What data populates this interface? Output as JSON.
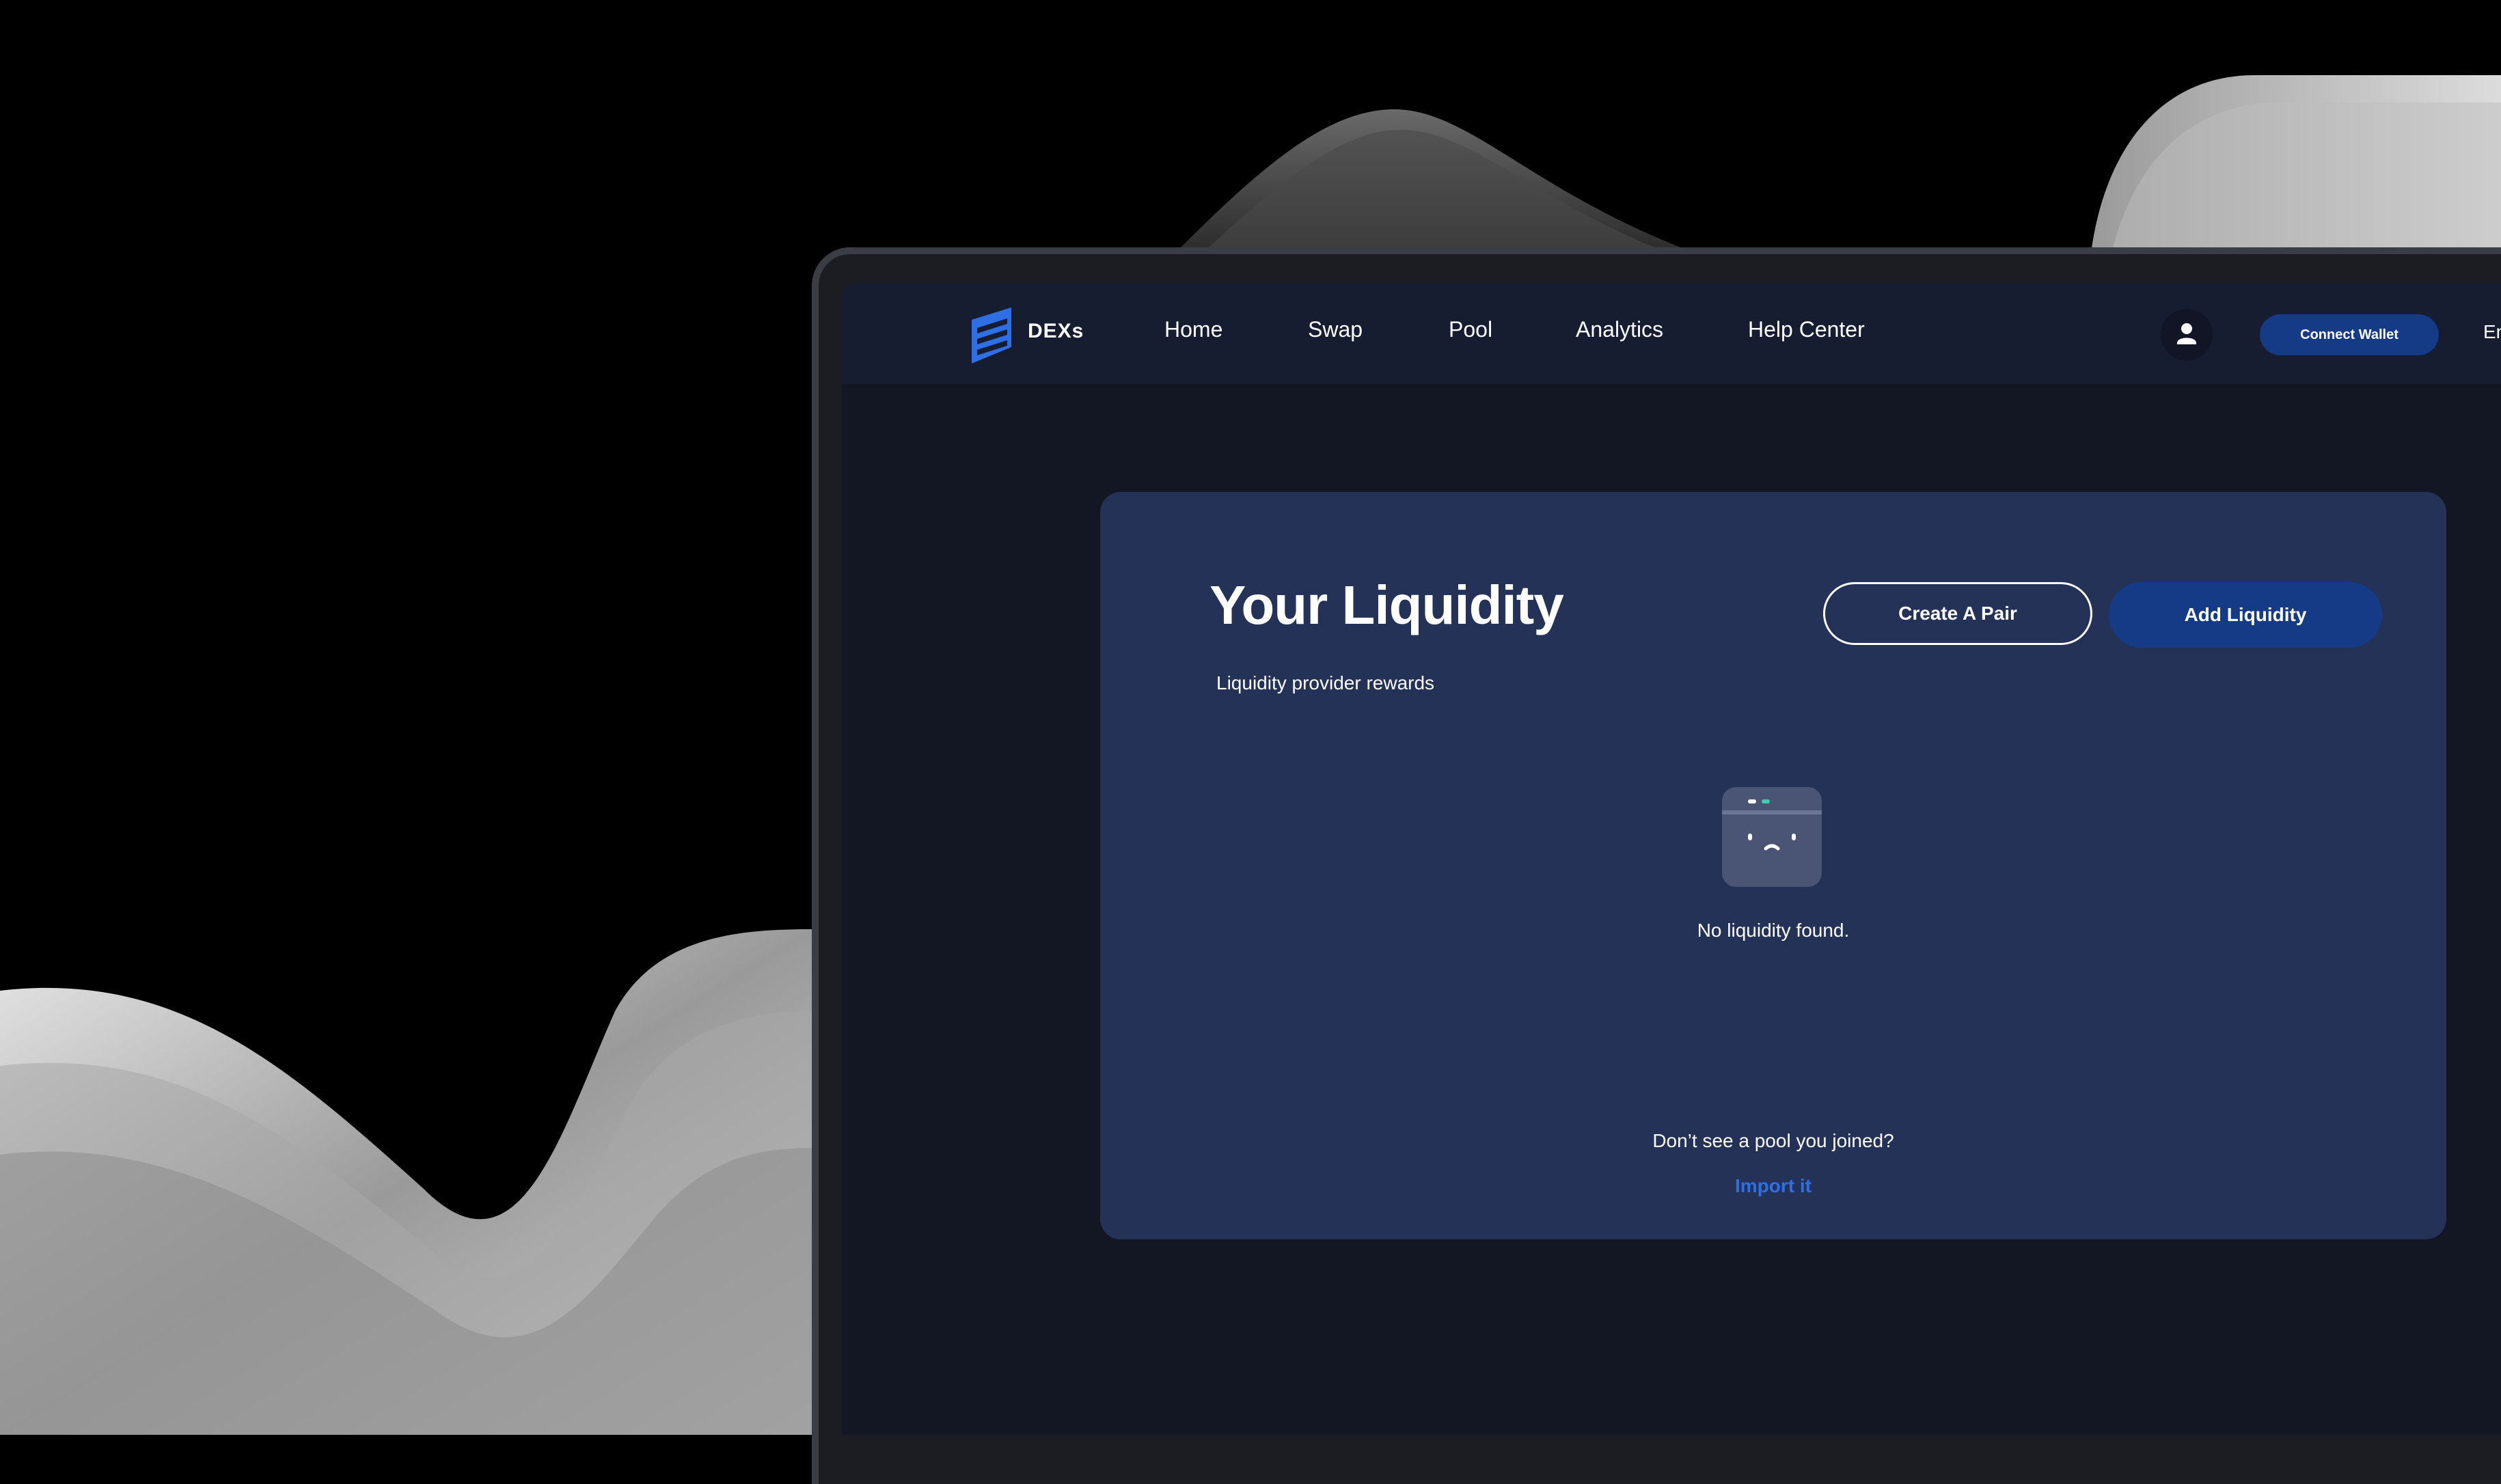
{
  "brand": {
    "name": "DEXs",
    "logo_icon": "dexs-logo-icon",
    "accent": "#2f6fe6"
  },
  "nav": {
    "items": [
      {
        "label": "Home"
      },
      {
        "label": "Swap"
      },
      {
        "label": "Pool"
      },
      {
        "label": "Analytics"
      },
      {
        "label": "Help Center"
      }
    ],
    "avatar_icon": "user-icon",
    "connect_label": "Connect Wallet",
    "language_partial": "En"
  },
  "liquidity": {
    "title": "Your Liquidity",
    "subtitle": "Liquidity provider rewards",
    "create_pair_label": "Create A Pair",
    "add_liquidity_label": "Add Liquidity",
    "empty_icon": "sad-window-icon",
    "empty_message": "No liquidity found.",
    "import_question": "Don’t see a pool you joined?",
    "import_link": "Import it"
  },
  "colors": {
    "navbar": "#171d30",
    "screen": "#131723",
    "card": "#253257",
    "button": "#153b86"
  }
}
